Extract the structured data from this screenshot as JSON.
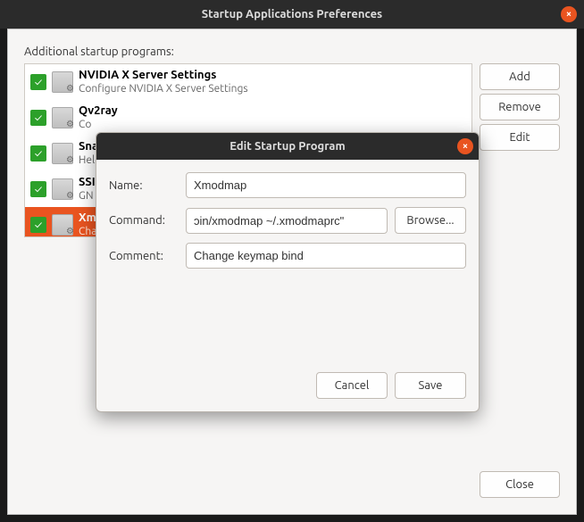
{
  "window": {
    "title": "Startup Applications Preferences",
    "section_label": "Additional startup programs:"
  },
  "buttons": {
    "add": "Add",
    "remove": "Remove",
    "edit": "Edit",
    "close": "Close"
  },
  "items": [
    {
      "name": "NVIDIA X Server Settings",
      "desc": "Configure NVIDIA X Server Settings",
      "checked": true,
      "selected": false
    },
    {
      "name": "Qv2ray",
      "desc": "Co",
      "checked": true,
      "selected": false
    },
    {
      "name": "Sna",
      "desc": "Hel",
      "checked": true,
      "selected": false
    },
    {
      "name": "SSI",
      "desc": "GN",
      "checked": true,
      "selected": false
    },
    {
      "name": "Xm",
      "desc": "Cha",
      "checked": true,
      "selected": true
    }
  ],
  "dialog": {
    "title": "Edit Startup Program",
    "labels": {
      "name": "Name:",
      "command": "Command:",
      "comment": "Comment:"
    },
    "values": {
      "name": "Xmodmap",
      "command": "ɔin/xmodmap ~/.xmodmaprc\"",
      "comment": "Change keymap bind"
    },
    "buttons": {
      "browse": "Browse...",
      "cancel": "Cancel",
      "save": "Save"
    }
  }
}
